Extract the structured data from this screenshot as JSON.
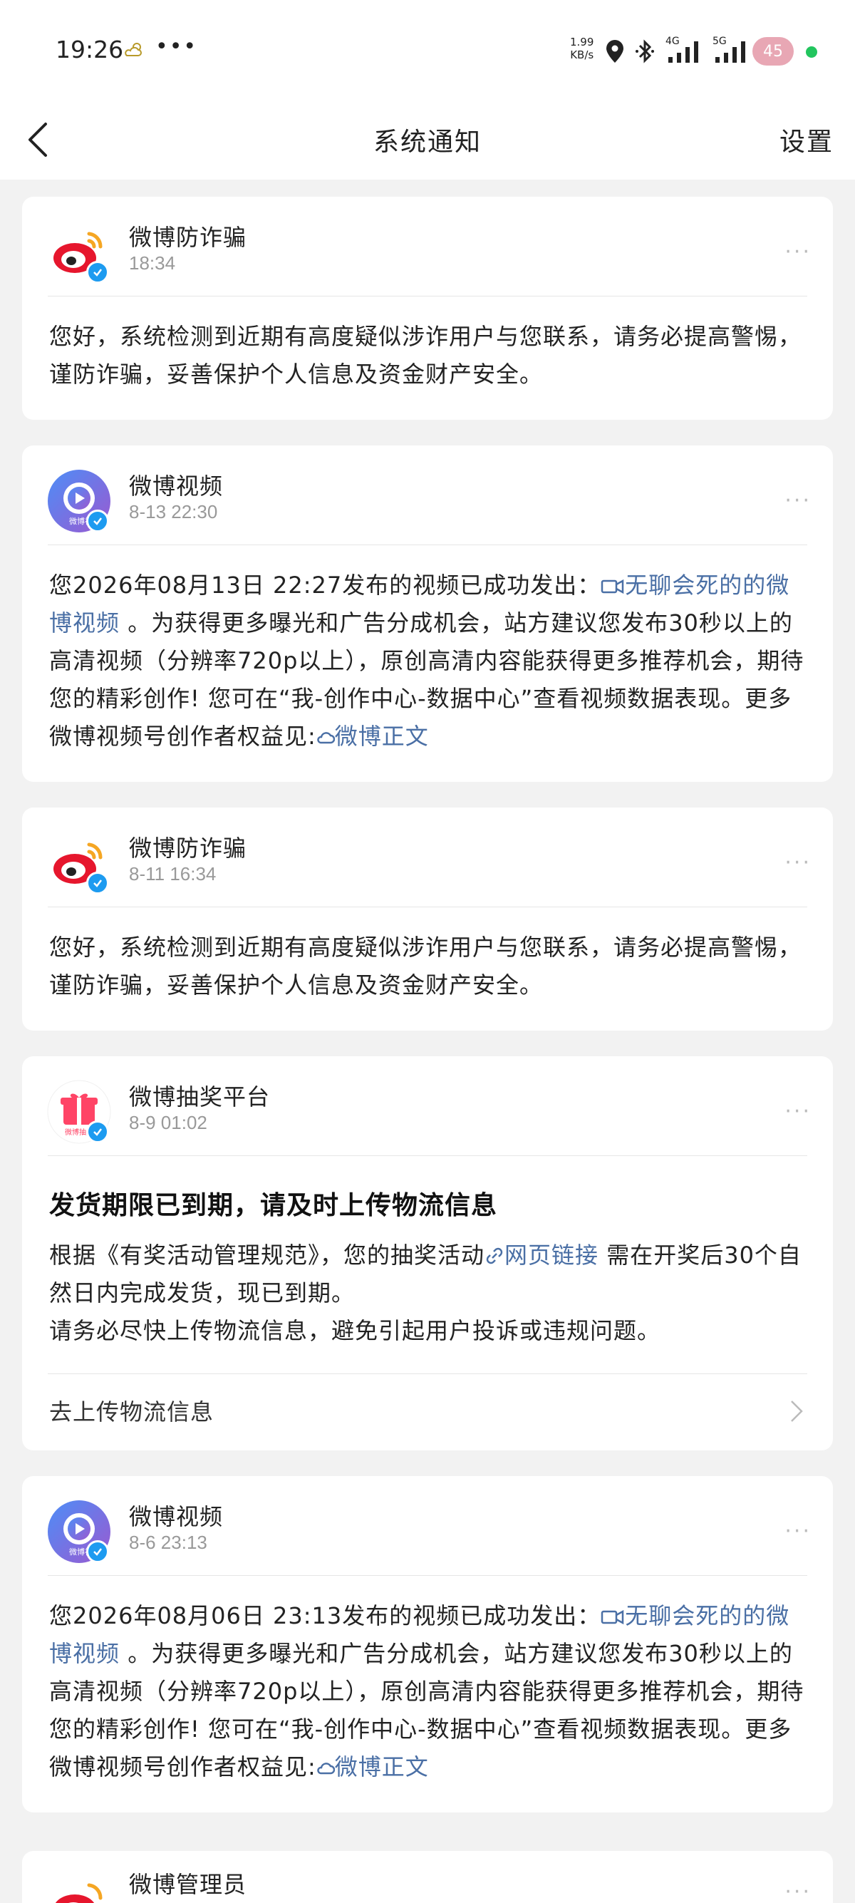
{
  "status_bar": {
    "time": "19:26",
    "net_speed_value": "1.99",
    "net_speed_unit": "KB/s",
    "signal_4g": "4G",
    "signal_5g": "5G",
    "battery": "45"
  },
  "header": {
    "title": "系统通知",
    "settings_label": "设置"
  },
  "notifications": [
    {
      "sender": "微博防诈骗",
      "time": "18:34",
      "text": "您好，系统检测到近期有高度疑似涉诈用户与您联系，请务必提高警惕，谨防诈骗，妥善保护个人信息及资金财产安全。"
    },
    {
      "sender": "微博视频",
      "time": "8-13 22:30",
      "avatar_caption": "微博视",
      "text_before": "您2026年08月13日  22:27发布的视频已成功发出：",
      "video_link": "无聊会死的的微博视频",
      "text_after": " 。为获得更多曝光和广告分成机会，站方建议您发布30秒以上的高清视频（分辨率720p以上），原创高清内容能获得更多推荐机会，期待您的精彩创作! 您可在“我-创作中心-数据中心”查看视频数据表现。更多微博视频号创作者权益见:",
      "article_link": "微博正文"
    },
    {
      "sender": "微博防诈骗",
      "time": "8-11 16:34",
      "text": "您好，系统检测到近期有高度疑似涉诈用户与您联系，请务必提高警惕，谨防诈骗，妥善保护个人信息及资金财产安全。"
    },
    {
      "sender": "微博抽奖平台",
      "time": "8-9 01:02",
      "avatar_caption": "微博抽奖",
      "headline": "发货期限已到期，请及时上传物流信息",
      "text_before": "根据《有奖活动管理规范》，您的抽奖活动",
      "web_link": "网页链接",
      "text_after": "  需在开奖后30个自然日内完成发货，现已到期。",
      "text_line3": "请务必尽快上传物流信息，避免引起用户投诉或违规问题。",
      "action_label": "去上传物流信息"
    },
    {
      "sender": "微博视频",
      "time": "8-6 23:13",
      "avatar_caption": "微博视",
      "text_before": "您2026年08月06日  23:13发布的视频已成功发出：",
      "video_link": "无聊会死的的微博视频",
      "text_after": " 。为获得更多曝光和广告分成机会，站方建议您发布30秒以上的高清视频（分辨率720p以上），原创高清内容能获得更多推荐机会，期待您的精彩创作! 您可在“我-创作中心-数据中心”查看视频数据表现。更多微博视频号创作者权益见:",
      "article_link": "微博正文"
    },
    {
      "sender": "微博管理员"
    }
  ],
  "more_label": "···",
  "colors": {
    "background": "#f2f2f2",
    "link": "#4a6fa5",
    "verified": "#1d9bf0",
    "weibo_red": "#e6162d",
    "weibo_orange": "#f5a623",
    "video_purple": "#6c5ce7",
    "lottery_red": "#ff4466"
  }
}
